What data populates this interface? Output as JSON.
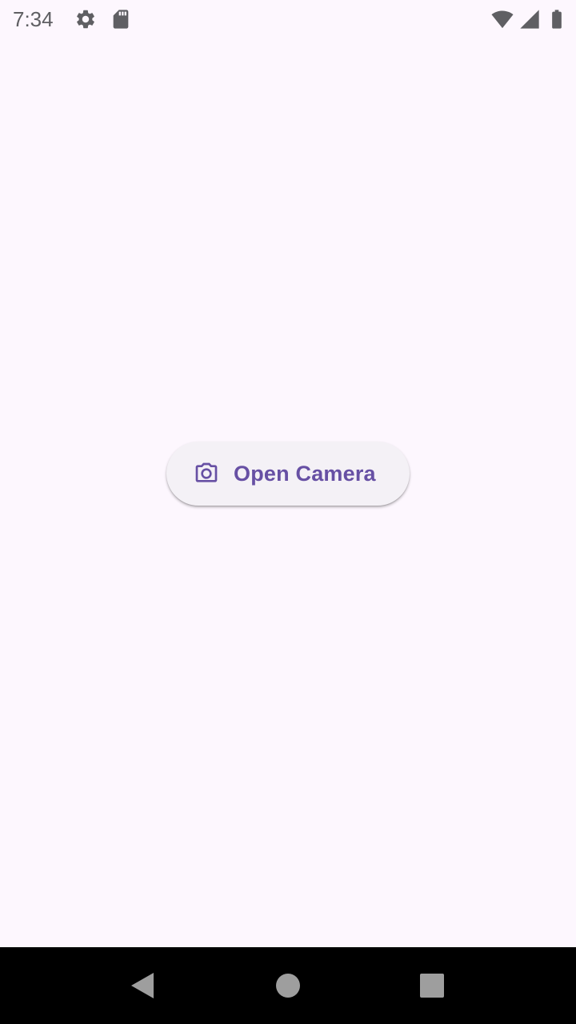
{
  "status_bar": {
    "time": "7:34",
    "icons": [
      "settings-gear-icon",
      "sd-card-icon",
      "wifi-icon",
      "cell-signal-icon",
      "battery-icon"
    ]
  },
  "main": {
    "open_camera_button": {
      "label": "Open Camera",
      "icon": "camera-icon"
    }
  },
  "nav_bar": {
    "buttons": [
      "back-icon",
      "home-icon",
      "recents-icon"
    ]
  },
  "colors": {
    "background": "#FDF7FE",
    "button_bg": "#F4F1F6",
    "accent": "#6750A4",
    "nav_bar": "#000000",
    "status_icons": "#5f5f63"
  }
}
